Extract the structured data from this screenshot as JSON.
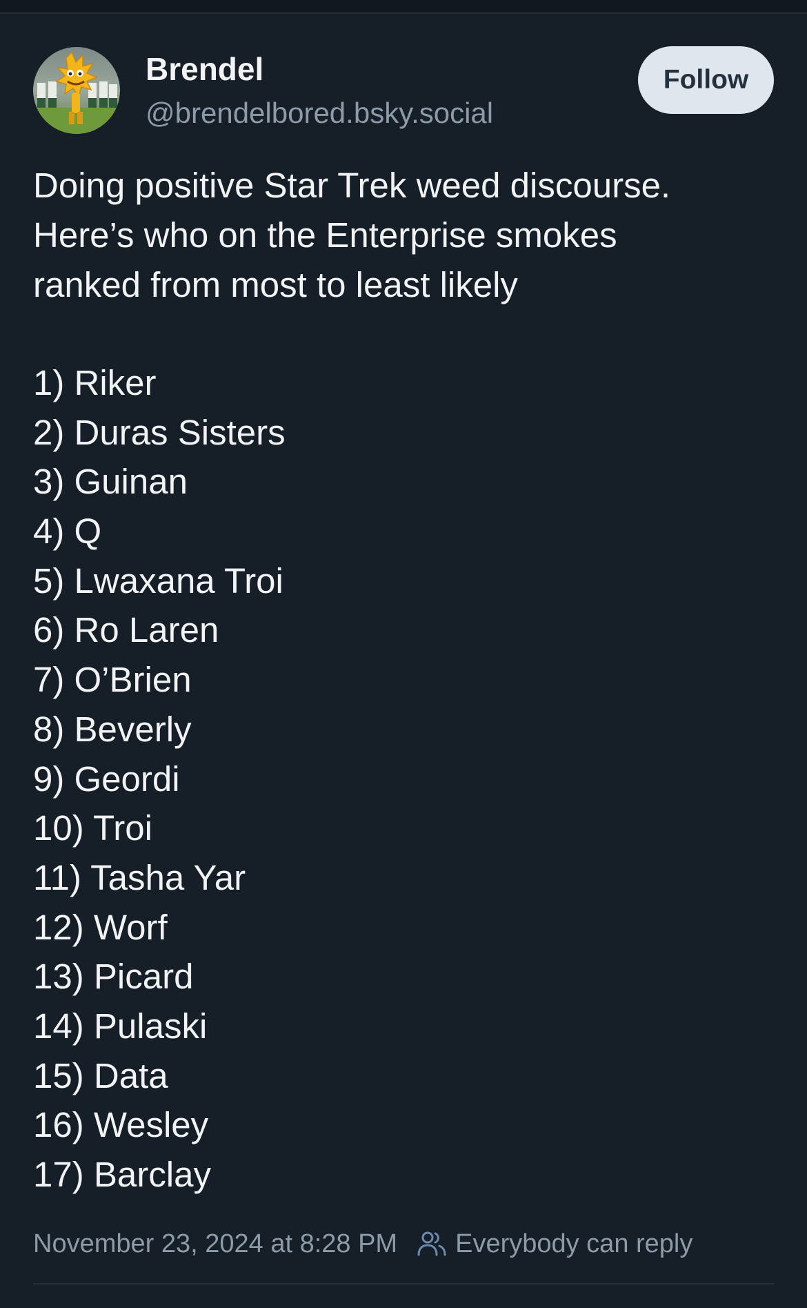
{
  "post": {
    "author": {
      "display_name": "Brendel",
      "handle": "@brendelbored.bsky.social"
    },
    "follow_label": "Follow",
    "text_lines": [
      "Doing positive Star Trek weed discourse.",
      "Here’s who on the Enterprise smokes",
      "ranked from most to least likely"
    ],
    "ranking": [
      "1) Riker",
      "2) Duras Sisters",
      "3) Guinan",
      "4) Q",
      "5) Lwaxana Troi",
      "6) Ro Laren",
      "7) O’Brien",
      "8) Beverly",
      "9) Geordi",
      "10) Troi",
      "11) Tasha Yar",
      "12) Worf",
      "13) Picard",
      "14) Pulaski",
      "15) Data",
      "16) Wesley",
      "17) Barclay"
    ],
    "timestamp": "November 23, 2024 at 8:28 PM",
    "reply_setting": "Everybody can reply",
    "reply_icon": "people-icon"
  },
  "colors": {
    "background": "#161e27",
    "text": "#f1f3f5",
    "muted": "#8d9aa8",
    "follow_bg": "#dfe6ee",
    "follow_text": "#25313d",
    "icon_accent": "#6c8bb0"
  }
}
